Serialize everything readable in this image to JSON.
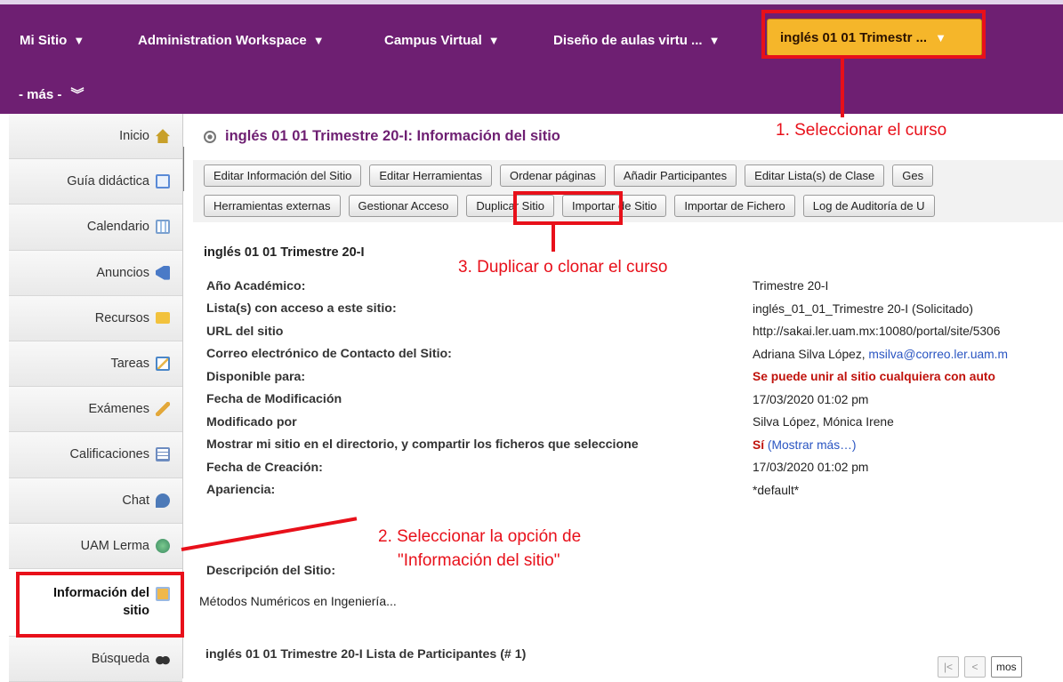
{
  "topnav": {
    "items": [
      "Mi Sitio",
      "Administration Workspace",
      "Campus Virtual",
      "Diseño de aulas virtu ..."
    ],
    "active": "inglés 01 01 Trimestr ...",
    "more": "- más -"
  },
  "sidebar": {
    "items": [
      {
        "label": "Inicio",
        "icon": "home-icon",
        "color": "#c8a02a"
      },
      {
        "label": "Guía didáctica",
        "icon": "document-icon",
        "color": "#5a8ad6"
      },
      {
        "label": "Calendario",
        "icon": "calendar-icon",
        "color": "#7aa0cf"
      },
      {
        "label": "Anuncios",
        "icon": "megaphone-icon",
        "color": "#4a7ac7"
      },
      {
        "label": "Recursos",
        "icon": "folder-icon",
        "color": "#f2c23d"
      },
      {
        "label": "Tareas",
        "icon": "edit-icon",
        "color": "#4b87c8"
      },
      {
        "label": "Exámenes",
        "icon": "pencil-icon",
        "color": "#e3a83a"
      },
      {
        "label": "Calificaciones",
        "icon": "gradebook-icon",
        "color": "#6d8cc0"
      },
      {
        "label": "Chat",
        "icon": "chat-icon",
        "color": "#4d7ab8"
      },
      {
        "label": "UAM Lerma",
        "icon": "globe-icon",
        "color": "#3a8a60"
      }
    ],
    "active": {
      "line1": "Información del",
      "line2": "sitio",
      "icon": "site-info-icon",
      "color": "#f0b84a"
    },
    "after": {
      "label": "Búsqueda",
      "icon": "binoculars-icon",
      "color": "#333333"
    }
  },
  "main": {
    "title": "inglés 01 01 Trimestre 20-I: Información del sitio",
    "toolbar_row1": [
      "Editar Información del Sitio",
      "Editar Herramientas",
      "Ordenar páginas",
      "Añadir Participantes",
      "Editar Lista(s) de Clase",
      "Ges"
    ],
    "toolbar_row2": [
      "Herramientas externas",
      "Gestionar Acceso",
      "Duplicar Sitio",
      "Importar de Sitio",
      "Importar de Fichero",
      "Log de Auditoría de U"
    ],
    "site_name": "inglés 01 01 Trimestre 20-I",
    "info": [
      {
        "key": "Año Académico:",
        "value": "Trimestre 20-I"
      },
      {
        "key": "Lista(s) con acceso a este sitio:",
        "value": "inglés_01_01_Trimestre 20-I (Solicitado)"
      },
      {
        "key": "URL del sitio",
        "value": "http://sakai.ler.uam.mx:10080/portal/site/5306"
      },
      {
        "key": "Correo electrónico de Contacto del Sitio:",
        "value": "Adriana Silva López, ",
        "link": "msilva@correo.ler.uam.m"
      },
      {
        "key": "Disponible para:",
        "value": "Se puede unir al sitio cualquiera con auto"
      },
      {
        "key": "Fecha de Modificación",
        "value": "17/03/2020 01:02 pm"
      },
      {
        "key": "Modificado por",
        "value": "Silva López, Mónica Irene"
      },
      {
        "key": "Mostrar mi sitio en el directorio, y compartir los ficheros que seleccione",
        "value": "Sí",
        "link": " (Mostrar más…)"
      },
      {
        "key": "Fecha de Creación:",
        "value": "17/03/2020 01:02 pm"
      },
      {
        "key": "Apariencia:",
        "value": "*default*"
      }
    ],
    "description_label": "Descripción del Sitio:",
    "description": "Métodos Numéricos en Ingeniería...",
    "participants_title": "inglés 01 01 Trimestre 20-I Lista de Participantes (# 1)",
    "pager": {
      "first": "|<",
      "prev": "<",
      "show": "mos"
    }
  },
  "annotations": {
    "step1": "1. Seleccionar el curso",
    "step2_line1": "2. Seleccionar la opción de",
    "step2_line2": "\"Información del sitio\"",
    "step3": "3. Duplicar o clonar el curso",
    "color": "#e8101a"
  },
  "colors": {
    "nav_bg": "#6e1f72",
    "nav_active": "#f5b62a",
    "title": "#6e1f72",
    "warn": "#c0120c",
    "link": "#2a55c2"
  }
}
